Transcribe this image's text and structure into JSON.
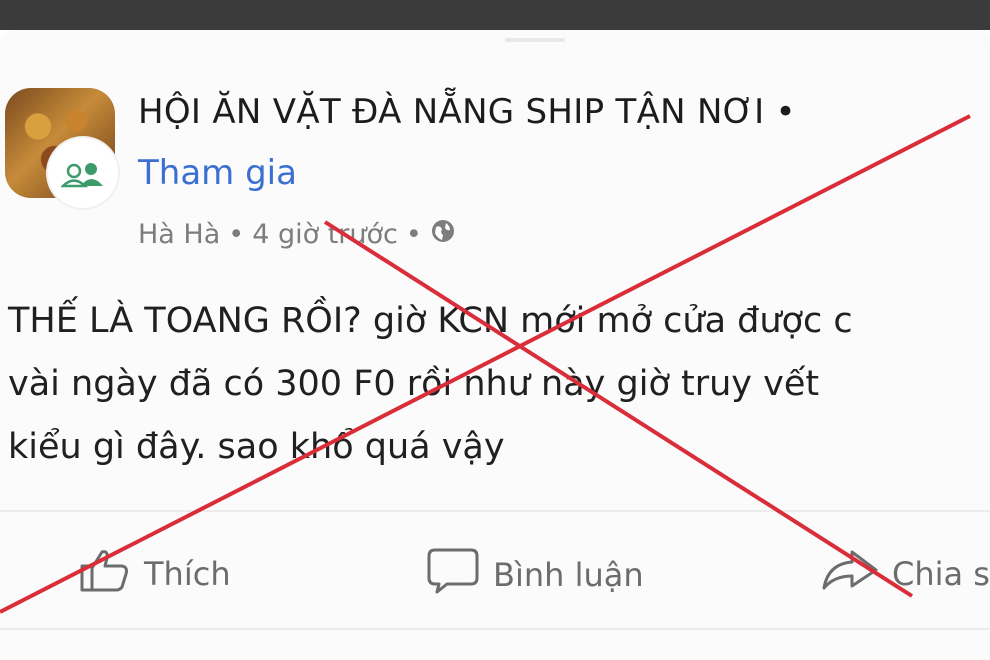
{
  "post": {
    "group_name": "HỘI ĂN VẶT ĐÀ NẴNG SHIP TẬN NƠI •",
    "join_label": "Tham gia",
    "author": "Hà Hà",
    "separator": "•",
    "time": "4 giờ trước",
    "text": "THẾ LÀ TOANG RỒI? giờ KCN mới mở cửa được c\nvài ngày đã có 300 F0 rồi như này giờ truy vết\nkiểu gì đây. sao khổ quá vậy"
  },
  "actions": {
    "like_label": "Thích",
    "comment_label": "Bình luận",
    "share_label": "Chia s"
  },
  "colors": {
    "overlay_x": "#d92d3a",
    "link": "#3b6fd1"
  }
}
